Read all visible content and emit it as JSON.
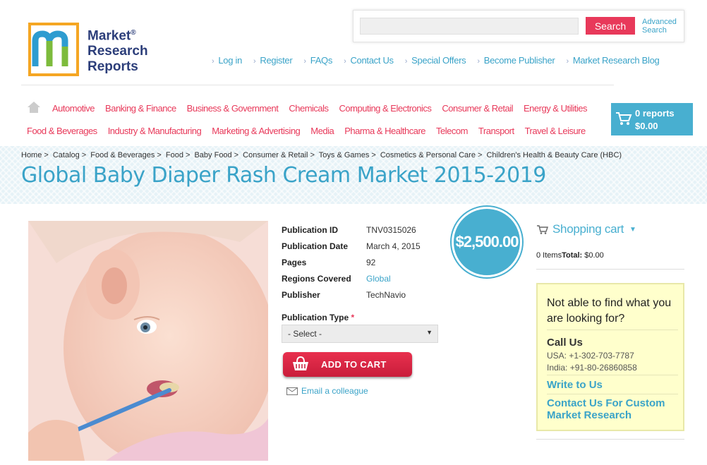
{
  "logo": {
    "line1": "Market",
    "line2": "Research",
    "line3": "Reports",
    "reg": "®"
  },
  "search": {
    "placeholder": "",
    "button": "Search",
    "advanced": "Advanced Search"
  },
  "top_links": [
    "Log in",
    "Register",
    "FAQs",
    "Contact Us",
    "Special Offers",
    "Become Publisher",
    "Market Research Blog"
  ],
  "categories_row1": [
    "Automotive",
    "Banking & Finance",
    "Business & Government",
    "Chemicals",
    "Computing & Electronics",
    "Consumer & Retail",
    "Energy & Utilities"
  ],
  "categories_row2": [
    "Food & Beverages",
    "Industry & Manufacturing",
    "Marketing & Advertising",
    "Media",
    "Pharma & Healthcare",
    "Telecom",
    "Transport",
    "Travel & Leisure"
  ],
  "cart": {
    "reports": "0 reports",
    "total": "$0.00"
  },
  "breadcrumb": [
    "Home",
    "Catalog",
    "Food & Beverages",
    "Food",
    "Baby Food",
    "Consumer & Retail",
    "Toys & Games",
    "Cosmetics & Personal Care",
    "Children's Health & Beauty Care (HBC)"
  ],
  "title": "Global Baby Diaper Rash Cream Market 2015-2019",
  "details": [
    {
      "key": "Publication ID",
      "value": "TNV0315026"
    },
    {
      "key": "Publication Date",
      "value": "March 4, 2015"
    },
    {
      "key": "Pages",
      "value": "92"
    },
    {
      "key": "Regions Covered",
      "value": "Global"
    },
    {
      "key": "Publisher",
      "value": "TechNavio"
    }
  ],
  "price": "$2,500.00",
  "publication_type": {
    "label": "Publication Type",
    "required": "*",
    "selected": "- Select -"
  },
  "add_to_cart": "ADD TO CART",
  "email_colleague": "Email a colleague",
  "shopping_cart": {
    "title": "Shopping cart",
    "items": "0 Items",
    "total_label": "Total:",
    "total": "$0.00"
  },
  "help": {
    "question": "Not able to find what you are looking for?",
    "call_title": "Call Us",
    "usa": "USA: +1-302-703-7787",
    "india": "India: +91-80-26860858",
    "write": "Write to Us",
    "custom": "Contact Us For Custom Market Research"
  },
  "colors": {
    "accent_blue": "#3aa3c8",
    "accent_pink": "#e8395a",
    "cart_blue": "#48afd0",
    "help_bg": "#ffffcc"
  }
}
